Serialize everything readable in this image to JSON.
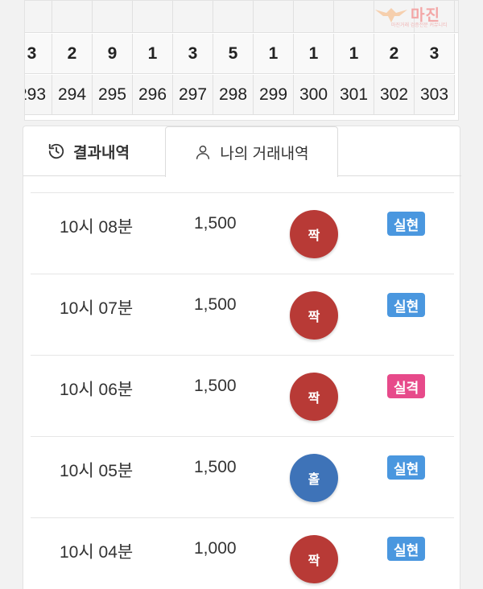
{
  "colors": {
    "even_ball": "#b83a36",
    "odd_ball": "#3e73b8",
    "success_badge": "#4a97df",
    "fail_badge": "#e74a8a"
  },
  "logo": {
    "text": "마진",
    "subtext": "마진거래 검증전문 커뮤니티",
    "icon": "eagle-icon"
  },
  "grid": {
    "row_top": [
      "",
      "",
      "",
      "",
      "",
      "",
      "",
      "",
      "",
      "",
      "",
      ""
    ],
    "row_results": [
      "3",
      "2",
      "9",
      "1",
      "3",
      "5",
      "1",
      "1",
      "1",
      "2",
      "3"
    ],
    "row_rounds": [
      "293",
      "294",
      "295",
      "296",
      "297",
      "298",
      "299",
      "300",
      "301",
      "302",
      "303"
    ]
  },
  "tabs": [
    {
      "label": "결과내역",
      "icon": "history-icon"
    },
    {
      "label": "나의 거래내역",
      "icon": "user-icon"
    }
  ],
  "rows": [
    {
      "time": "10시 08분",
      "amount": "1,500",
      "pick": "짝",
      "pick_type": "even",
      "result": "실현",
      "result_type": "success"
    },
    {
      "time": "10시 07분",
      "amount": "1,500",
      "pick": "짝",
      "pick_type": "even",
      "result": "실현",
      "result_type": "success"
    },
    {
      "time": "10시 06분",
      "amount": "1,500",
      "pick": "짝",
      "pick_type": "even",
      "result": "실격",
      "result_type": "fail"
    },
    {
      "time": "10시 05분",
      "amount": "1,500",
      "pick": "홀",
      "pick_type": "odd",
      "result": "실현",
      "result_type": "success"
    },
    {
      "time": "10시 04분",
      "amount": "1,000",
      "pick": "짝",
      "pick_type": "even",
      "result": "실현",
      "result_type": "success"
    }
  ]
}
